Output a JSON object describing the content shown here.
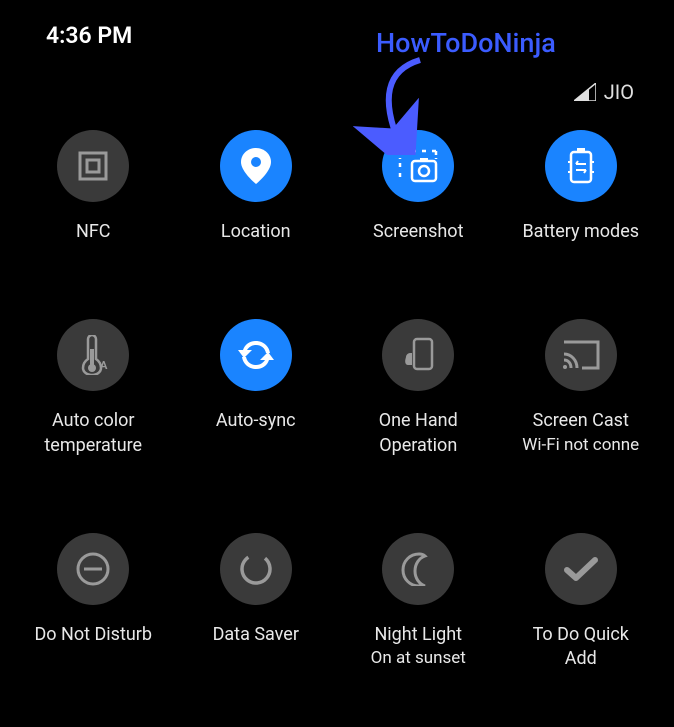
{
  "status": {
    "time": "4:36 PM",
    "carrier": "JIO"
  },
  "annotation": {
    "text": "HowToDoNinja"
  },
  "colors": {
    "active": "#1a84ff",
    "inactive": "#3a3a3a",
    "arrow": "#4b5cff"
  },
  "tiles": [
    {
      "name": "nfc",
      "label": "NFC",
      "sublabel": "",
      "active": false,
      "icon": "nfc-icon"
    },
    {
      "name": "location",
      "label": "Location",
      "sublabel": "",
      "active": true,
      "icon": "location-icon"
    },
    {
      "name": "screenshot",
      "label": "Screenshot",
      "sublabel": "",
      "active": true,
      "icon": "screenshot-icon"
    },
    {
      "name": "battery-modes",
      "label": "Battery modes",
      "sublabel": "",
      "active": true,
      "icon": "battery-icon"
    },
    {
      "name": "auto-color-temperature",
      "label": "Auto color\ntemperature",
      "sublabel": "",
      "active": false,
      "icon": "thermometer-icon"
    },
    {
      "name": "auto-sync",
      "label": "Auto-sync",
      "sublabel": "",
      "active": true,
      "icon": "sync-icon"
    },
    {
      "name": "one-hand-operation",
      "label": "One Hand\nOperation",
      "sublabel": "",
      "active": false,
      "icon": "one-hand-icon"
    },
    {
      "name": "screen-cast",
      "label": "Screen Cast",
      "sublabel": "Wi-Fi not conne",
      "active": false,
      "icon": "cast-icon"
    },
    {
      "name": "do-not-disturb",
      "label": "Do Not Disturb",
      "sublabel": "",
      "active": false,
      "icon": "dnd-icon"
    },
    {
      "name": "data-saver",
      "label": "Data Saver",
      "sublabel": "",
      "active": false,
      "icon": "data-saver-icon"
    },
    {
      "name": "night-light",
      "label": "Night Light",
      "sublabel": "On at sunset",
      "active": false,
      "icon": "night-light-icon"
    },
    {
      "name": "to-do-quick-add",
      "label": "To Do Quick\nAdd",
      "sublabel": "",
      "active": false,
      "icon": "todo-icon"
    }
  ]
}
